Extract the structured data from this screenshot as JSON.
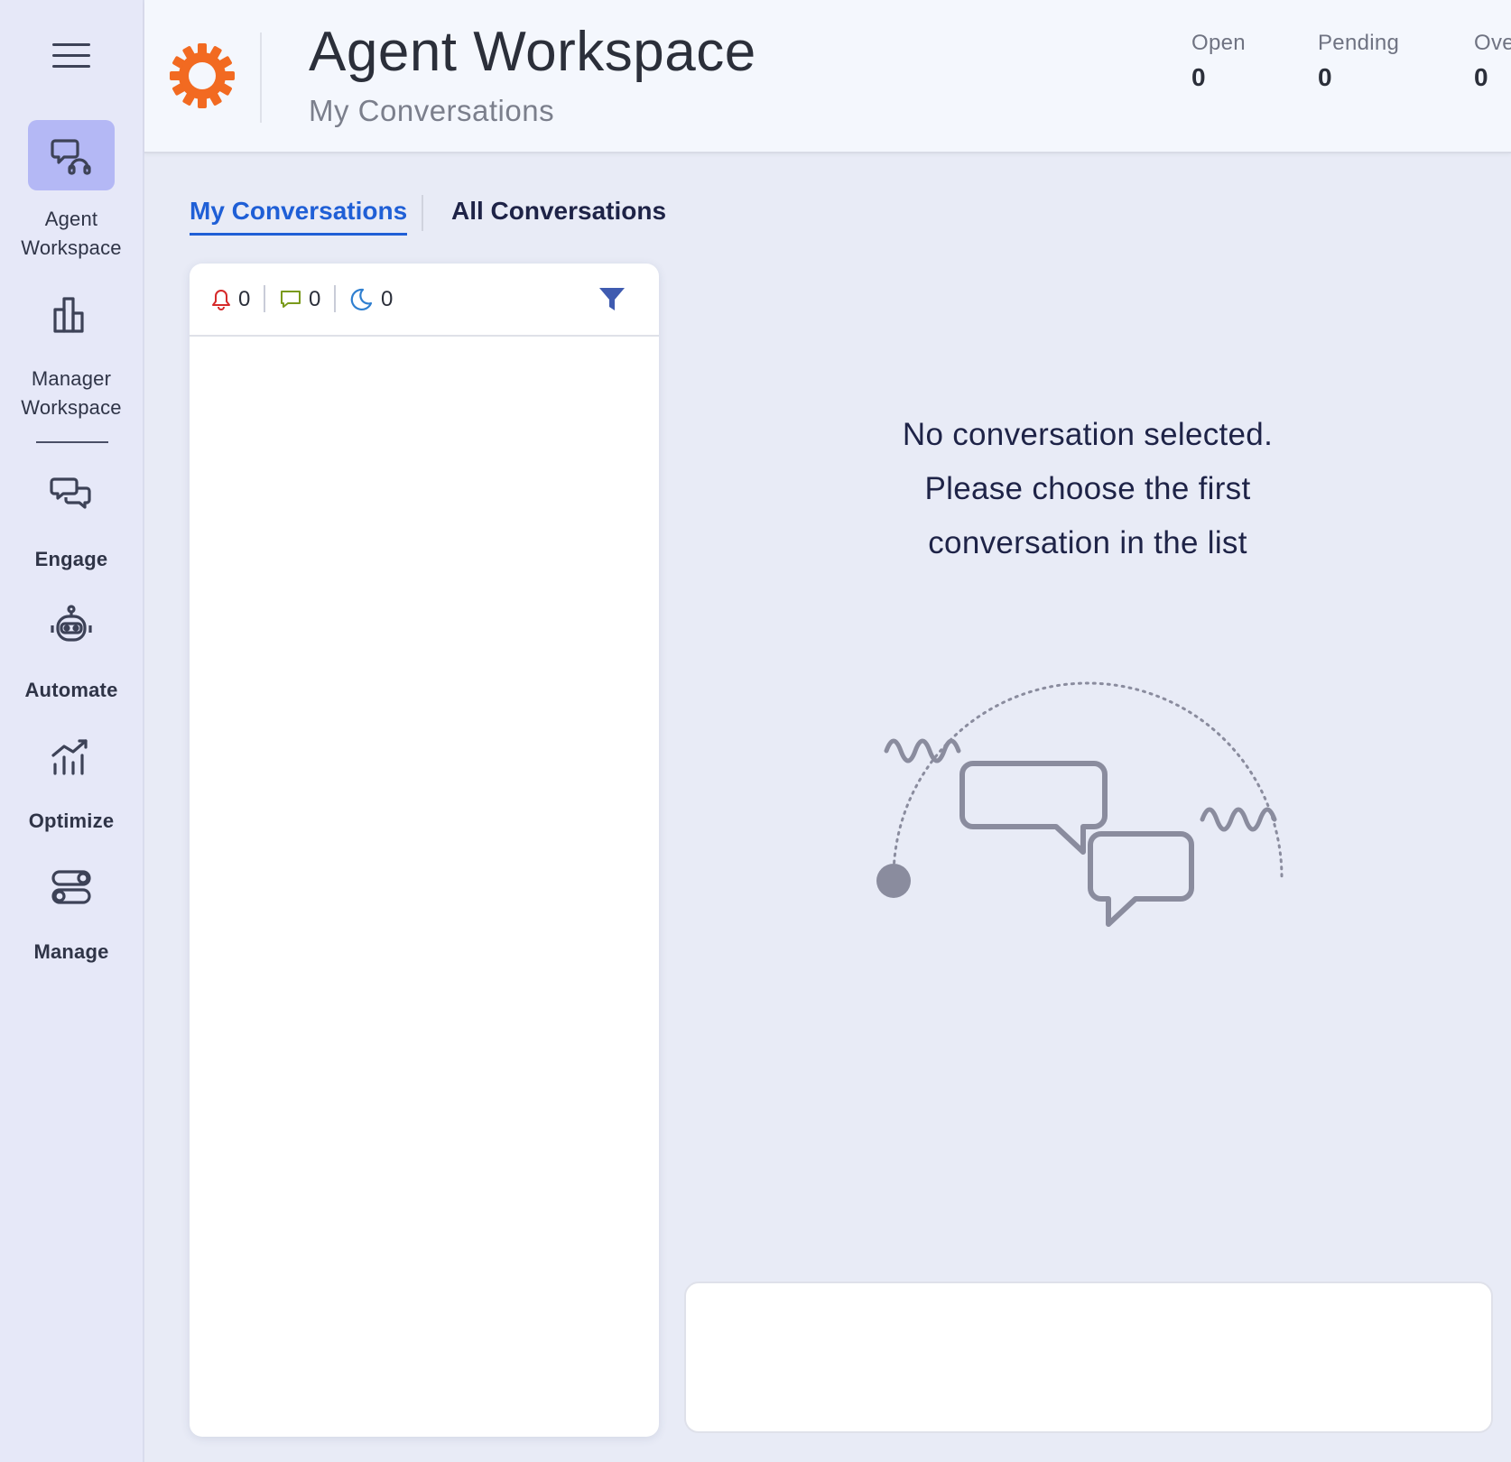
{
  "sidebar": {
    "items": [
      {
        "label_line1": "Agent",
        "label_line2": "Workspace",
        "icon": "agent-headset-chat-icon",
        "active": true
      },
      {
        "label_line1": "Manager",
        "label_line2": "Workspace",
        "icon": "bar-chart-icon"
      },
      {
        "label_line1": "Engage",
        "icon": "chat-bubbles-icon"
      },
      {
        "label_line1": "Automate",
        "icon": "robot-icon"
      },
      {
        "label_line1": "Optimize",
        "icon": "trend-chart-icon"
      },
      {
        "label_line1": "Manage",
        "icon": "toggles-icon"
      }
    ]
  },
  "header": {
    "title": "Agent Workspace",
    "subtitle": "My Conversations",
    "stats": [
      {
        "label": "Open",
        "value": "0"
      },
      {
        "label": "Pending",
        "value": "0"
      },
      {
        "label": "Ove",
        "value": "0"
      }
    ]
  },
  "tabs": [
    {
      "label": "My Conversations",
      "active": true
    },
    {
      "label": "All Conversations",
      "active": false
    }
  ],
  "list": {
    "counters": [
      {
        "icon": "bell-icon",
        "value": "0",
        "color": "#d62a2a"
      },
      {
        "icon": "chat-icon",
        "value": "0",
        "color": "#7a9a1c"
      },
      {
        "icon": "moon-icon",
        "value": "0",
        "color": "#2f7fd0"
      }
    ],
    "filter_icon": "filter-icon"
  },
  "empty_state": {
    "line1": "No conversation selected.",
    "line2": "Please choose the first",
    "line3": "conversation in the list"
  },
  "colors": {
    "accent": "#1f5fd6",
    "brand_orange": "#f26a21",
    "sidebar_active": "#b4b8f5"
  }
}
